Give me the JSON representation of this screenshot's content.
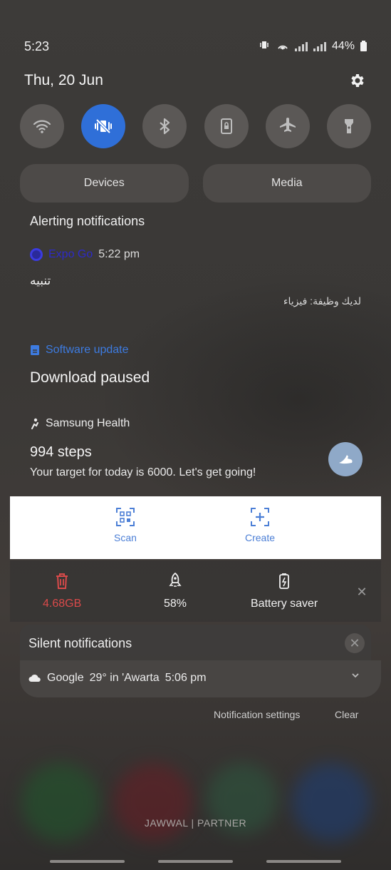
{
  "status_bar": {
    "time": "5:23",
    "battery": "44%"
  },
  "header": {
    "date": "Thu, 20 Jun"
  },
  "quick_settings": [
    {
      "icon": "wifi-icon",
      "active": false
    },
    {
      "icon": "vibrate-icon",
      "active": true
    },
    {
      "icon": "bluetooth-icon",
      "active": false
    },
    {
      "icon": "portrait-lock-icon",
      "active": false
    },
    {
      "icon": "airplane-icon",
      "active": false
    },
    {
      "icon": "flashlight-icon",
      "active": false
    }
  ],
  "pills": {
    "devices": "Devices",
    "media": "Media"
  },
  "alerting": {
    "title": "Alerting notifications"
  },
  "expo": {
    "app": "Expo Go",
    "time": "5:22 pm",
    "title": "تنبيه",
    "body": "لديك وظيفة: فيزياء"
  },
  "software_update": {
    "app": "Software update",
    "text": "Download paused"
  },
  "samsung_health": {
    "app": "Samsung Health",
    "steps": "994 steps",
    "body": "Your target for today is 6000. Let's get going!"
  },
  "actions": {
    "scan": "Scan",
    "create": "Create"
  },
  "device_care": {
    "storage": "4.68GB",
    "memory": "58%",
    "battery": "Battery saver"
  },
  "silent": {
    "title": "Silent notifications"
  },
  "google": {
    "app": "Google",
    "temp": "29° in 'Awarta",
    "time": "5:06 pm"
  },
  "footer": {
    "settings": "Notification settings",
    "clear": "Clear",
    "carrier": "JAWWAL | PARTNER"
  },
  "colors": {
    "accent": "#2f6fd8",
    "action_blue": "#4c7fd6",
    "storage_red": "#d94a4a"
  }
}
